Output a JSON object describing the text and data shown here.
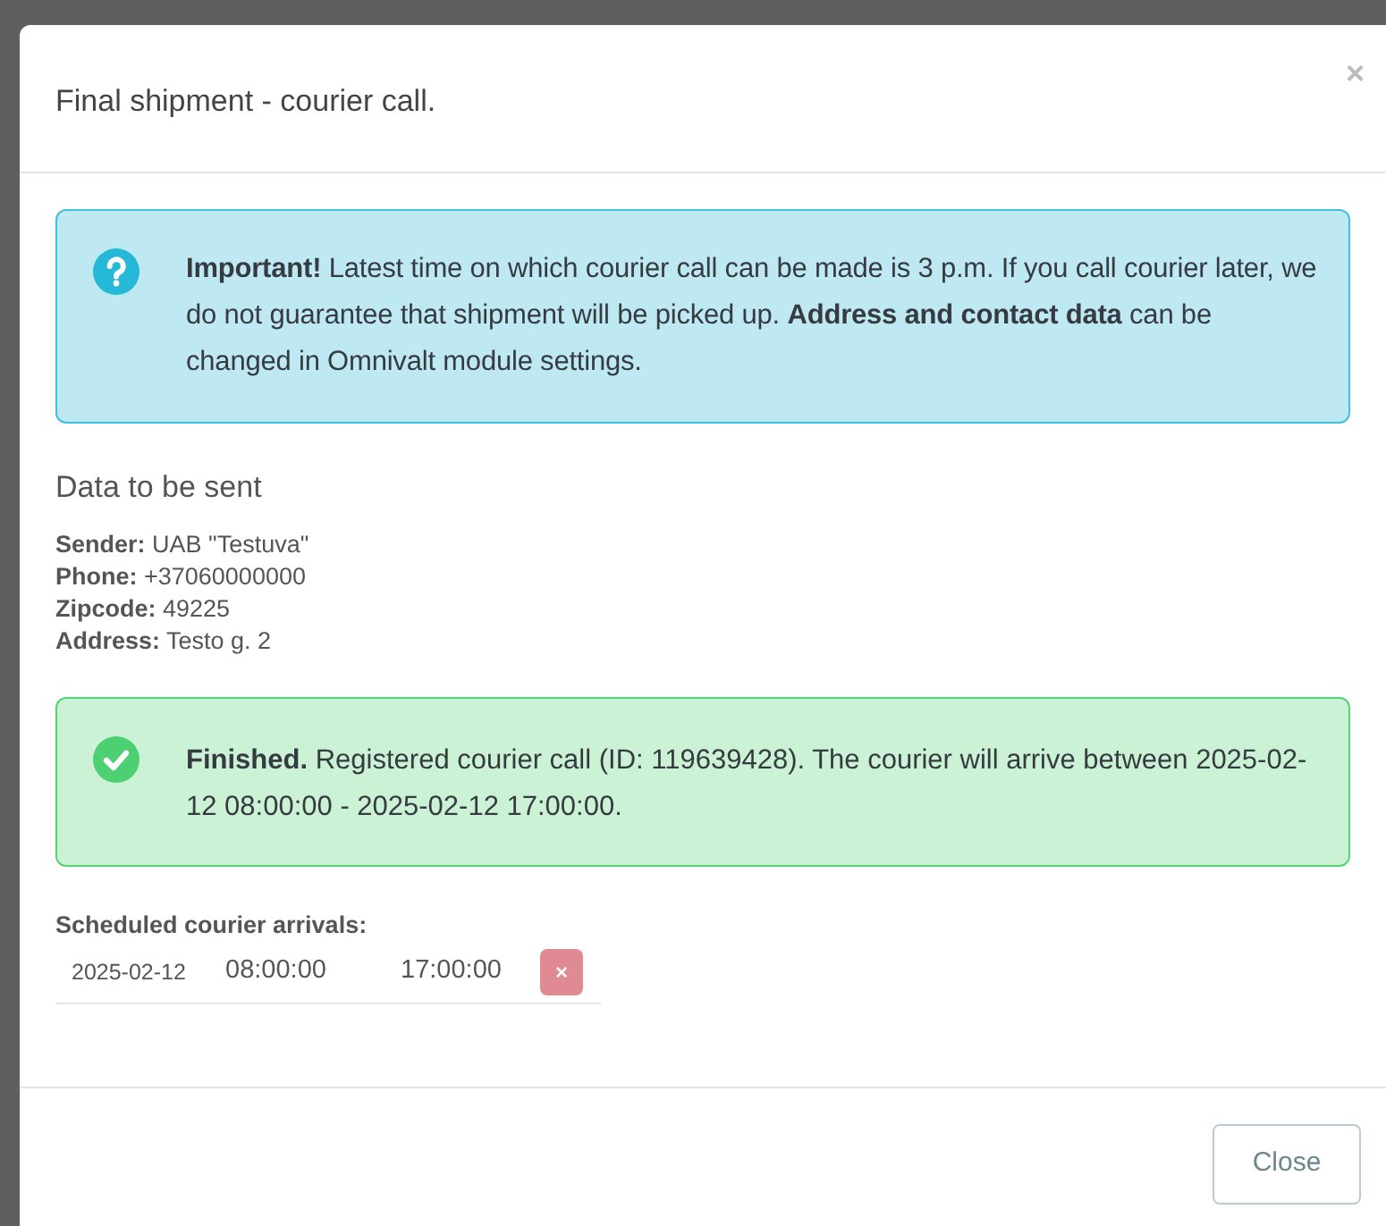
{
  "modal": {
    "title": "Final shipment - courier call.",
    "close_icon": "×"
  },
  "info_alert": {
    "text": "**Important!** Latest time on which courier call can be made is 3 p.m. If you call courier later, we do not guarantee that shipment will be picked up. **Address and contact data** can be changed in Omnivalt module settings."
  },
  "data_section": {
    "heading": "Data to be sent",
    "fields": [
      {
        "text": "**Sender:** UAB \"Testuva\""
      },
      {
        "text": "**Phone:** +37060000000"
      },
      {
        "text": "**Zipcode:** 49225"
      },
      {
        "text": "**Address:** Testo g. 2"
      }
    ]
  },
  "success_alert": {
    "text": "**Finished.** Registered courier call (ID: 119639428). The courier will arrive between 2025-02-12 08:00:00 - 2025-02-12 17:00:00."
  },
  "arrivals": {
    "heading": "Scheduled courier arrivals:",
    "rows": [
      {
        "date": "2025-02-12",
        "from": "08:00:00",
        "to": "17:00:00",
        "remove": "×"
      }
    ]
  },
  "footer": {
    "close_button": "Close"
  }
}
